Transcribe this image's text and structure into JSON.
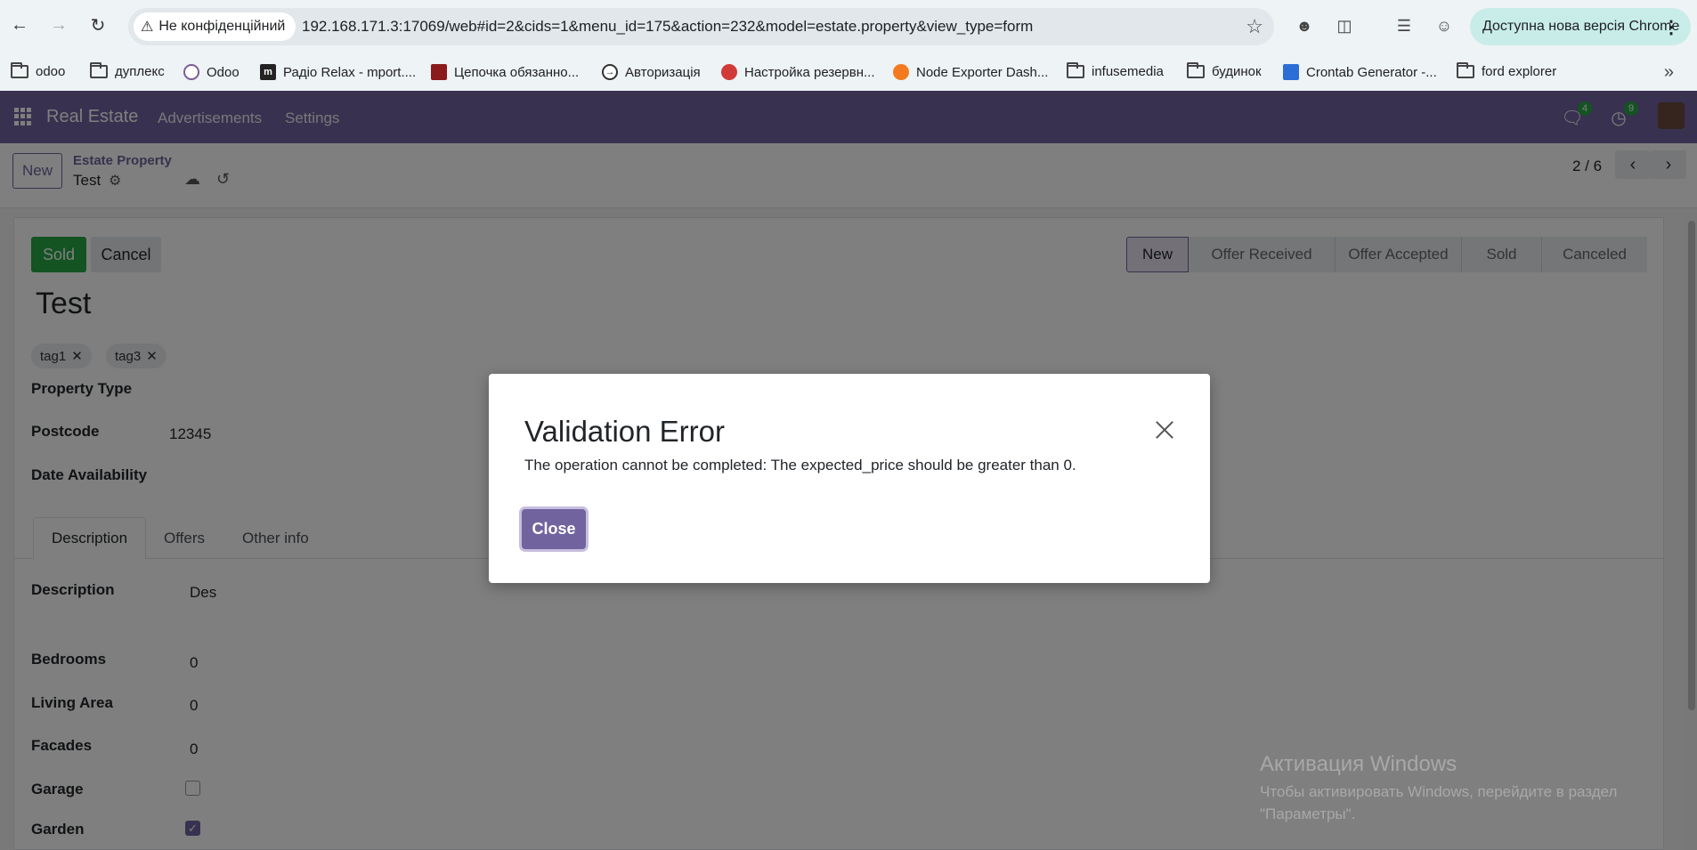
{
  "browser": {
    "security_label": "Не конфіденційний",
    "url": "192.168.171.3:17069/web#id=2&cids=1&menu_id=175&action=232&model=estate.property&view_type=form",
    "update_chip": "Доступна нова версія Chrome"
  },
  "bookmarks": [
    {
      "label": "odoo",
      "icon": "folder-icon"
    },
    {
      "label": "дуплекс",
      "icon": "folder-icon"
    },
    {
      "label": "Odoo",
      "icon": "odoo-icon"
    },
    {
      "label": "Радіо Relax - mport....",
      "icon": "m-icon"
    },
    {
      "label": "Цепочка обязанно...",
      "icon": "site-icon"
    },
    {
      "label": "Авторизація",
      "icon": "login-icon"
    },
    {
      "label": "Настройка резервн...",
      "icon": "site-icon"
    },
    {
      "label": "Node Exporter Dash...",
      "icon": "grafana-icon"
    },
    {
      "label": "infusemedia",
      "icon": "folder-icon"
    },
    {
      "label": "будинок",
      "icon": "folder-icon"
    },
    {
      "label": "Crontab Generator -...",
      "icon": "site-icon"
    },
    {
      "label": "ford explorer",
      "icon": "folder-icon"
    }
  ],
  "navbar": {
    "brand": "Real Estate",
    "menu": [
      "Advertisements",
      "Settings"
    ],
    "messages_count": "4",
    "activities_count": "9"
  },
  "control_panel": {
    "new_label": "New",
    "breadcrumb_parent": "Estate Property",
    "breadcrumb_current": "Test",
    "pager": "2 / 6"
  },
  "form": {
    "buttons": {
      "sold": "Sold",
      "cancel": "Cancel"
    },
    "status_steps": [
      "New",
      "Offer Received",
      "Offer Accepted",
      "Sold",
      "Canceled"
    ],
    "active_status": "New",
    "title": "Test",
    "tags": [
      "tag1",
      "tag3"
    ],
    "fields": {
      "property_type_label": "Property Type",
      "postcode_label": "Postcode",
      "postcode_value": "12345",
      "date_availability_label": "Date Availability"
    },
    "tabs": [
      "Description",
      "Offers",
      "Other info"
    ],
    "description_fields": {
      "description_label": "Description",
      "description_value": "Des",
      "bedrooms_label": "Bedrooms",
      "bedrooms_value": "0",
      "living_area_label": "Living Area",
      "living_area_value": "0",
      "facades_label": "Facades",
      "facades_value": "0",
      "garage_label": "Garage",
      "garden_label": "Garden"
    }
  },
  "windows_activation": {
    "title": "Активация Windows",
    "text": "Чтобы активировать Windows, перейдите в раздел \"Параметры\"."
  },
  "dialog": {
    "title": "Validation Error",
    "message": "The operation cannot be completed: The expected_price should be greater than 0.",
    "close_label": "Close"
  },
  "colors": {
    "primary": "#71639e",
    "success": "#28a745"
  }
}
